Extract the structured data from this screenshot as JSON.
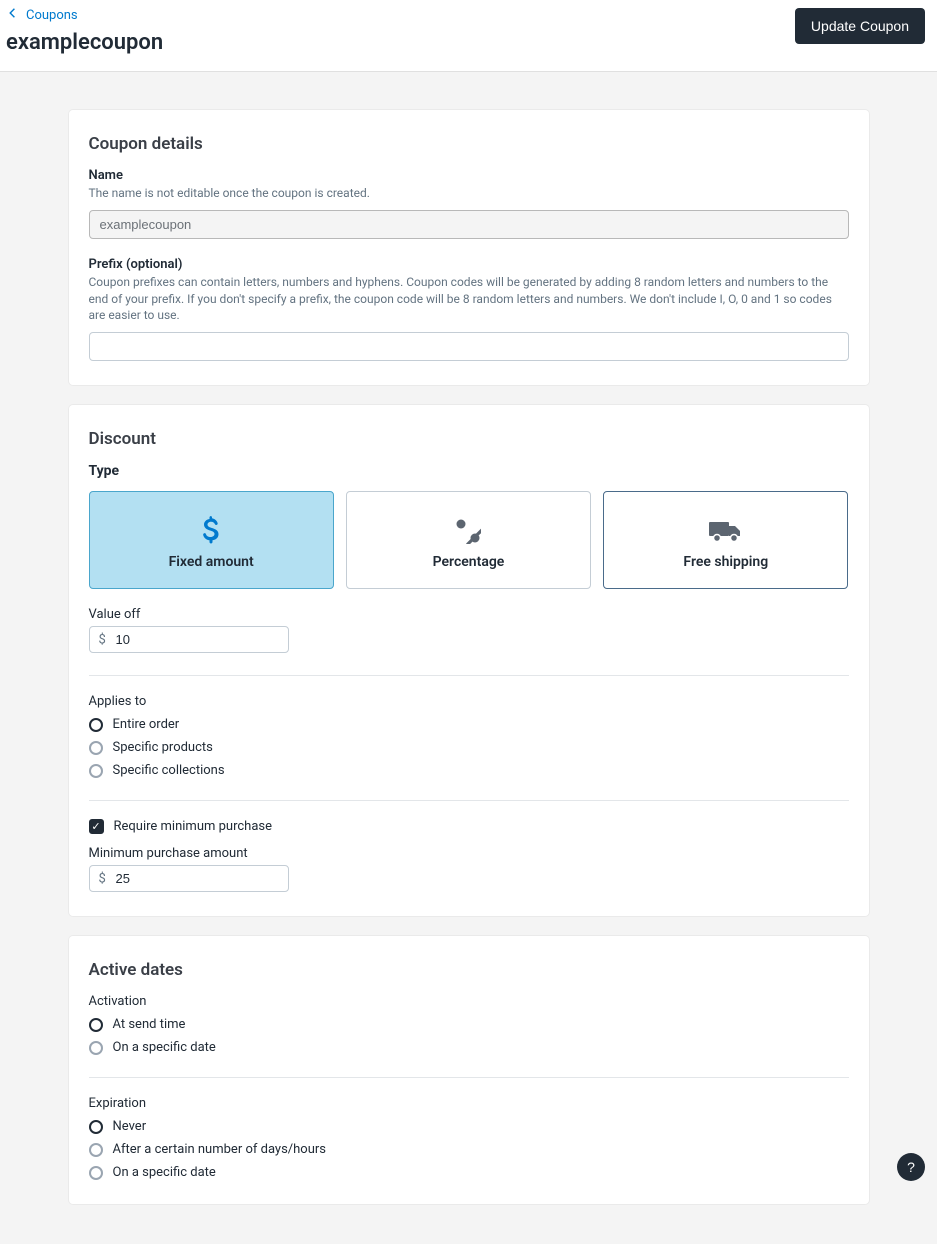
{
  "breadcrumb": {
    "label": "Coupons"
  },
  "page": {
    "title": "examplecoupon"
  },
  "actions": {
    "update": "Update Coupon"
  },
  "details": {
    "card_title": "Coupon details",
    "name_label": "Name",
    "name_help": "The name is not editable once the coupon is created.",
    "name_value": "examplecoupon",
    "prefix_label": "Prefix (optional)",
    "prefix_help": "Coupon prefixes can contain letters, numbers and hyphens. Coupon codes will be generated by adding 8 random letters and numbers to the end of your prefix. If you don't specify a prefix, the coupon code will be 8 random letters and numbers. We don't include I, O, 0 and 1 so codes are easier to use.",
    "prefix_value": ""
  },
  "discount": {
    "card_title": "Discount",
    "type_label": "Type",
    "types": {
      "fixed": "Fixed amount",
      "percentage": "Percentage",
      "free_shipping": "Free shipping"
    },
    "value_off_label": "Value off",
    "value_off_currency": "$",
    "value_off_value": "10",
    "applies_to_label": "Applies to",
    "applies_options": {
      "entire": "Entire order",
      "products": "Specific products",
      "collections": "Specific collections"
    },
    "require_min_label": "Require minimum purchase",
    "min_amount_label": "Minimum purchase amount",
    "min_amount_currency": "$",
    "min_amount_value": "25"
  },
  "dates": {
    "card_title": "Active dates",
    "activation_label": "Activation",
    "activation_options": {
      "send_time": "At send time",
      "specific": "On a specific date"
    },
    "expiration_label": "Expiration",
    "expiration_options": {
      "never": "Never",
      "after": "After a certain number of days/hours",
      "specific": "On a specific date"
    }
  },
  "help": {
    "label": "?"
  }
}
